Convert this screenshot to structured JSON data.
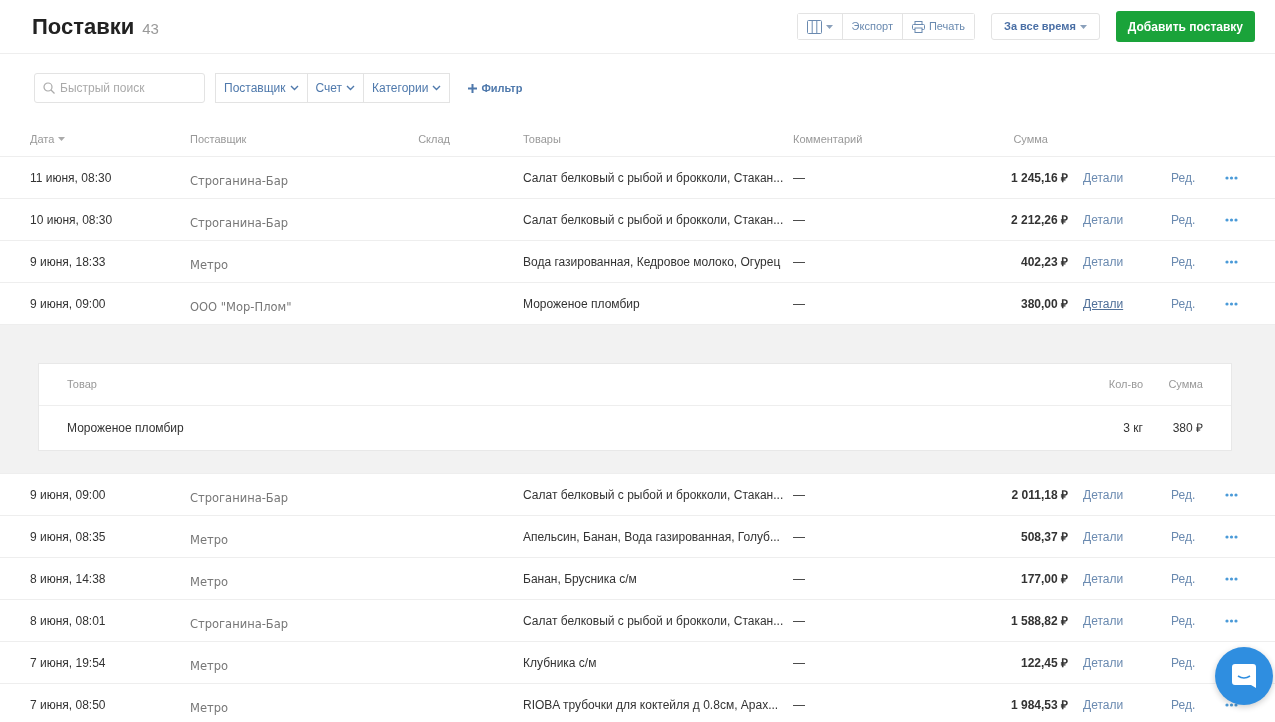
{
  "page": {
    "title": "Поставки",
    "count": "43"
  },
  "toolbar": {
    "export": "Экспорт",
    "print": "Печать",
    "period": "За все время",
    "add": "Добавить поставку"
  },
  "filters": {
    "search": {
      "placeholder": "Быстрый поиск"
    },
    "dropdowns": [
      "Поставщик",
      "Счет",
      "Категории"
    ],
    "add_filter": "Фильтр"
  },
  "table": {
    "columns": [
      "Дата",
      "Поставщик",
      "Склад",
      "Товары",
      "Комментарий",
      "Сумма"
    ],
    "rows": [
      {
        "date": "11 июня, 08:30",
        "supplier": "Строганина-Бар",
        "items": "Салат белковый с рыбой и брокколи, Стакан...",
        "comment": "—",
        "sum": "1 245,16 ₽",
        "details": "Детали",
        "edit": "Ред.",
        "expanded": false
      },
      {
        "date": "10 июня, 08:30",
        "supplier": "Строганина-Бар",
        "items": "Салат белковый с рыбой и брокколи, Стакан...",
        "comment": "—",
        "sum": "2 212,26 ₽",
        "details": "Детали",
        "edit": "Ред.",
        "expanded": false
      },
      {
        "date": "9 июня, 18:33",
        "supplier": "Метро",
        "items": "Вода газированная, Кедровое молоко, Огурец",
        "comment": "—",
        "sum": "402,23 ₽",
        "details": "Детали",
        "edit": "Ред.",
        "expanded": false
      },
      {
        "date": "9 июня, 09:00",
        "supplier": "ООО \"Мор-Плом\"",
        "items": "Мороженое пломбир",
        "comment": "—",
        "sum": "380,00 ₽",
        "details": "Детали",
        "edit": "Ред.",
        "expanded": true,
        "detail": {
          "columns": [
            "Товар",
            "Кол-во",
            "Сумма"
          ],
          "rows": [
            {
              "product": "Мороженое пломбир",
              "qty": "3 кг",
              "sum": "380 ₽"
            }
          ]
        }
      },
      {
        "date": "9 июня, 09:00",
        "supplier": "Строганина-Бар",
        "items": "Салат белковый с рыбой и брокколи, Стакан...",
        "comment": "—",
        "sum": "2 011,18 ₽",
        "details": "Детали",
        "edit": "Ред.",
        "expanded": false
      },
      {
        "date": "9 июня, 08:35",
        "supplier": "Метро",
        "items": "Апельсин, Банан, Вода газированная, Голуб...",
        "comment": "—",
        "sum": "508,37 ₽",
        "details": "Детали",
        "edit": "Ред.",
        "expanded": false
      },
      {
        "date": "8 июня, 14:38",
        "supplier": "Метро",
        "items": "Банан, Брусника с/м",
        "comment": "—",
        "sum": "177,00 ₽",
        "details": "Детали",
        "edit": "Ред.",
        "expanded": false
      },
      {
        "date": "8 июня, 08:01",
        "supplier": "Строганина-Бар",
        "items": "Салат белковый с рыбой и брокколи, Стакан...",
        "comment": "—",
        "sum": "1 588,82 ₽",
        "details": "Детали",
        "edit": "Ред.",
        "expanded": false
      },
      {
        "date": "7 июня, 19:54",
        "supplier": "Метро",
        "items": "Клубника с/м",
        "comment": "—",
        "sum": "122,45 ₽",
        "details": "Детали",
        "edit": "Ред.",
        "expanded": false
      },
      {
        "date": "7 июня, 08:50",
        "supplier": "Метро",
        "items": "RIOBA трубочки для коктейля д 0.8см, Арах...",
        "comment": "—",
        "sum": "1 984,53 ₽",
        "details": "Детали",
        "edit": "Ред.",
        "expanded": false
      }
    ]
  }
}
